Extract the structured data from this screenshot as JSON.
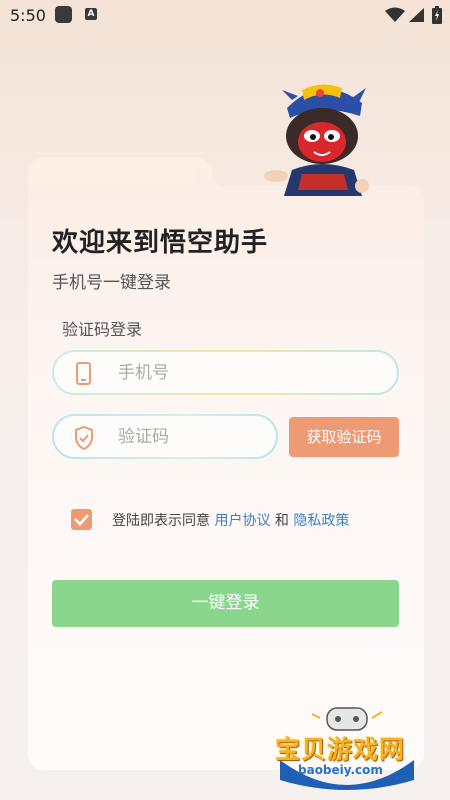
{
  "status_bar": {
    "time": "5:50",
    "icons": [
      "app-icon",
      "a-icon",
      "wifi-icon",
      "signal-icon",
      "battery-icon"
    ]
  },
  "header": {
    "title": "欢迎来到悟空助手",
    "subtitle": "手机号一键登录"
  },
  "form": {
    "section_label": "验证码登录",
    "phone_placeholder": "手机号",
    "code_placeholder": "验证码",
    "get_code_label": "获取验证码",
    "agree_prefix": "登陆即表示同意",
    "user_agreement": "用户协议",
    "and_text": "和",
    "privacy_policy": "隐私政策",
    "agree_checked": true,
    "login_label": "一键登录"
  },
  "watermark": {
    "logo_text": "宝贝游戏网",
    "url": "baobeiy.com"
  },
  "colors": {
    "accent_orange": "#ee9a74",
    "login_green": "#8ad68d",
    "link_blue": "#3b82c4"
  }
}
